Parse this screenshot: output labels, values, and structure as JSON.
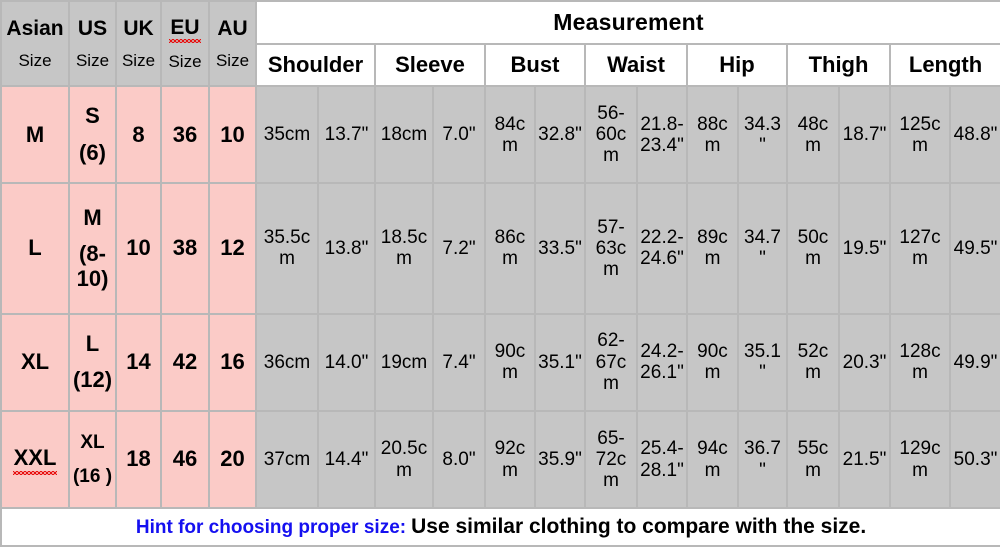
{
  "header": {
    "region_columns": [
      {
        "name": "Asian",
        "sub": "Size",
        "misspelled": false
      },
      {
        "name": "US",
        "sub": "Size",
        "misspelled": false
      },
      {
        "name": "UK",
        "sub": "Size",
        "misspelled": false
      },
      {
        "name": "EU",
        "sub": "Size",
        "misspelled": true
      },
      {
        "name": "AU",
        "sub": "Size",
        "misspelled": false
      }
    ],
    "measurement_title": "Measurement",
    "measurement_columns": [
      "Shoulder",
      "Sleeve",
      "Bust",
      "Waist",
      "Hip",
      "Thigh",
      "Length"
    ]
  },
  "rows": [
    {
      "asian": "M",
      "us_line1": "S",
      "us_line2": "(6)",
      "uk": "8",
      "eu": "36",
      "au": "10",
      "asian_misspelled": false,
      "shoulder_cm": "35cm",
      "shoulder_in": "13.7\"",
      "sleeve_cm": "18cm",
      "sleeve_in": "7.0\"",
      "bust_cm": "84cm",
      "bust_in": "32.8\"",
      "waist_cm": "56-60cm",
      "waist_in": "21.8-23.4\"",
      "hip_cm": "88cm",
      "hip_in": "34.3\"",
      "thigh_cm": "48cm",
      "thigh_in": "18.7\"",
      "length_cm": "125cm",
      "length_in": "48.8\""
    },
    {
      "asian": "L",
      "us_line1": "M",
      "us_line2": "(8-10)",
      "uk": "10",
      "eu": "38",
      "au": "12",
      "asian_misspelled": false,
      "shoulder_cm": "35.5cm",
      "shoulder_in": "13.8\"",
      "sleeve_cm": "18.5cm",
      "sleeve_in": "7.2\"",
      "bust_cm": "86cm",
      "bust_in": "33.5\"",
      "waist_cm": "57-63cm",
      "waist_in": "22.2-24.6\"",
      "hip_cm": "89cm",
      "hip_in": "34.7\"",
      "thigh_cm": "50cm",
      "thigh_in": "19.5\"",
      "length_cm": "127cm",
      "length_in": "49.5\""
    },
    {
      "asian": "XL",
      "us_line1": "L",
      "us_line2": "(12)",
      "uk": "14",
      "eu": "42",
      "au": "16",
      "asian_misspelled": false,
      "shoulder_cm": "36cm",
      "shoulder_in": "14.0\"",
      "sleeve_cm": "19cm",
      "sleeve_in": "7.4\"",
      "bust_cm": "90cm",
      "bust_in": "35.1\"",
      "waist_cm": "62-67cm",
      "waist_in": "24.2-26.1\"",
      "hip_cm": "90cm",
      "hip_in": "35.1\"",
      "thigh_cm": "52cm",
      "thigh_in": "20.3\"",
      "length_cm": "128cm",
      "length_in": "49.9\""
    },
    {
      "asian": "XXL",
      "us_line1": "XL",
      "us_line2": "(16 )",
      "uk": "18",
      "eu": "46",
      "au": "20",
      "asian_misspelled": true,
      "shoulder_cm": "37cm",
      "shoulder_in": "14.4\"",
      "sleeve_cm": "20.5cm",
      "sleeve_in": "8.0\"",
      "bust_cm": "92cm",
      "bust_in": "35.9\"",
      "waist_cm": "65-72cm",
      "waist_in": "25.4-28.1\"",
      "hip_cm": "94cm",
      "hip_in": "36.7\"",
      "thigh_cm": "55cm",
      "thigh_in": "21.5\"",
      "length_cm": "129cm",
      "length_in": "50.3\""
    }
  ],
  "footer": {
    "hint_label": "Hint for choosing proper size:",
    "hint_text": "Use similar clothing to compare with the size."
  },
  "colors": {
    "size_cell_bg": "#fbcbc7",
    "measurement_cell_bg": "#c6c6c6",
    "header_bg": "#ffffff",
    "border": "#b8b8b8",
    "hint_accent": "#1510f0",
    "spellcheck_underline": "#e81010"
  }
}
